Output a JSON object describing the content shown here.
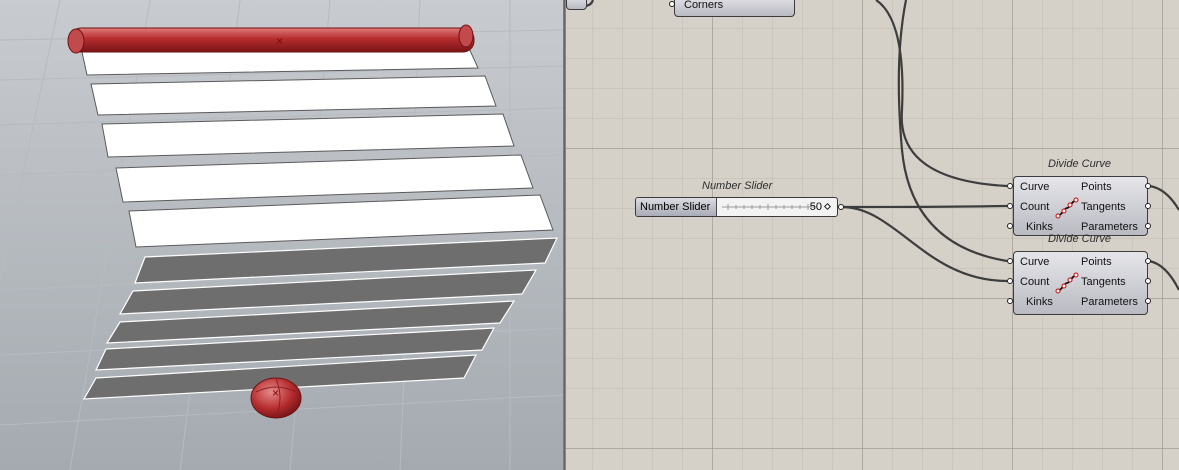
{
  "viewport": {
    "background_colors": [
      "#a2a8ae",
      "#c9ccd0"
    ],
    "selected_color": "#b0282a",
    "slat_white_color": "#ffffff",
    "slat_gray_color": "#6e6e6e"
  },
  "canvas": {
    "background_color": "#d5d1c8",
    "corners_node": {
      "output_label": "Corners"
    },
    "number_slider": {
      "title": "Number Slider",
      "label": "Number Slider",
      "value": "50"
    },
    "divide_curve_1": {
      "title": "Divide Curve",
      "inputs": [
        "Curve",
        "Count",
        "Kinks"
      ],
      "outputs": [
        "Points",
        "Tangents",
        "Parameters"
      ],
      "icon": "divide-curve-icon"
    },
    "divide_curve_2": {
      "title": "Divide Curve",
      "inputs": [
        "Curve",
        "Count",
        "Kinks"
      ],
      "outputs": [
        "Points",
        "Tangents",
        "Parameters"
      ],
      "icon": "divide-curve-icon"
    }
  }
}
